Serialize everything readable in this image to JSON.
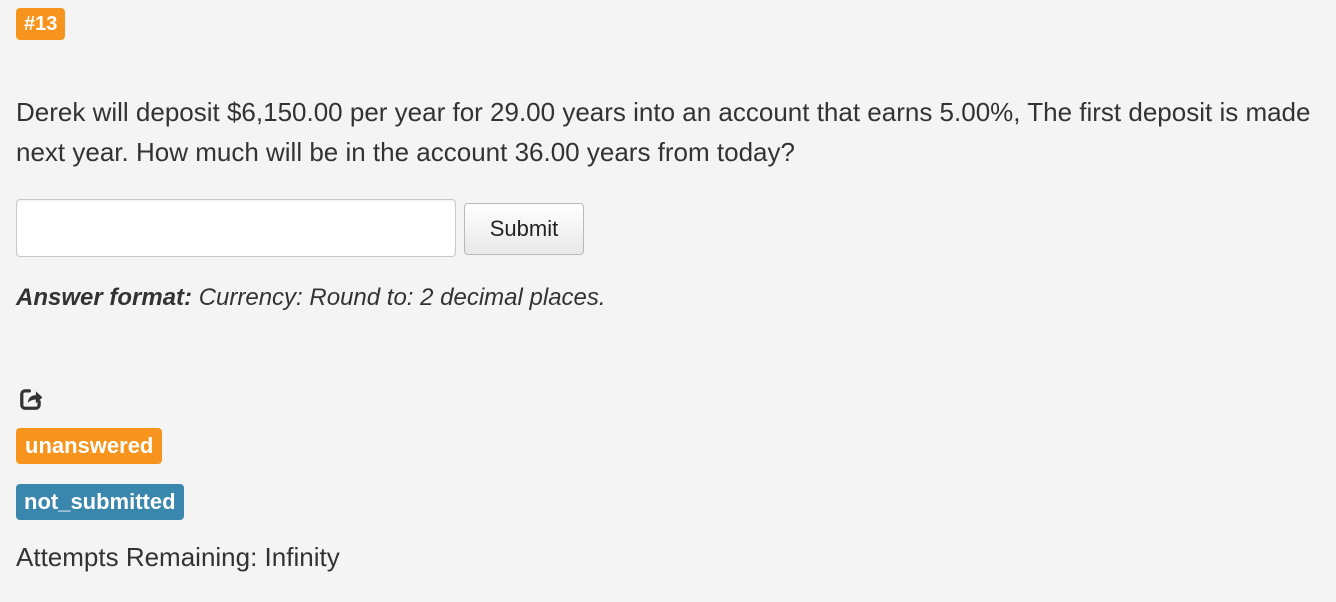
{
  "problem": {
    "number_badge": "#13",
    "question_text": "Derek will deposit $6,150.00 per year for 29.00 years into an account that earns 5.00%, The first deposit is made next year. How much will be in the account 36.00 years from today?"
  },
  "answer": {
    "input_value": "",
    "submit_label": "Submit",
    "format_label": "Answer format:",
    "format_text": " Currency: Round to: 2 decimal places."
  },
  "status": {
    "share_icon": "share-icon",
    "answer_state": "unanswered",
    "submission_state": "not_submitted",
    "attempts_text": "Attempts Remaining: Infinity"
  },
  "colors": {
    "background": "#f4f4f4",
    "orange_badge": "#f7941d",
    "blue_badge": "#3a87ad",
    "text": "#333333"
  }
}
